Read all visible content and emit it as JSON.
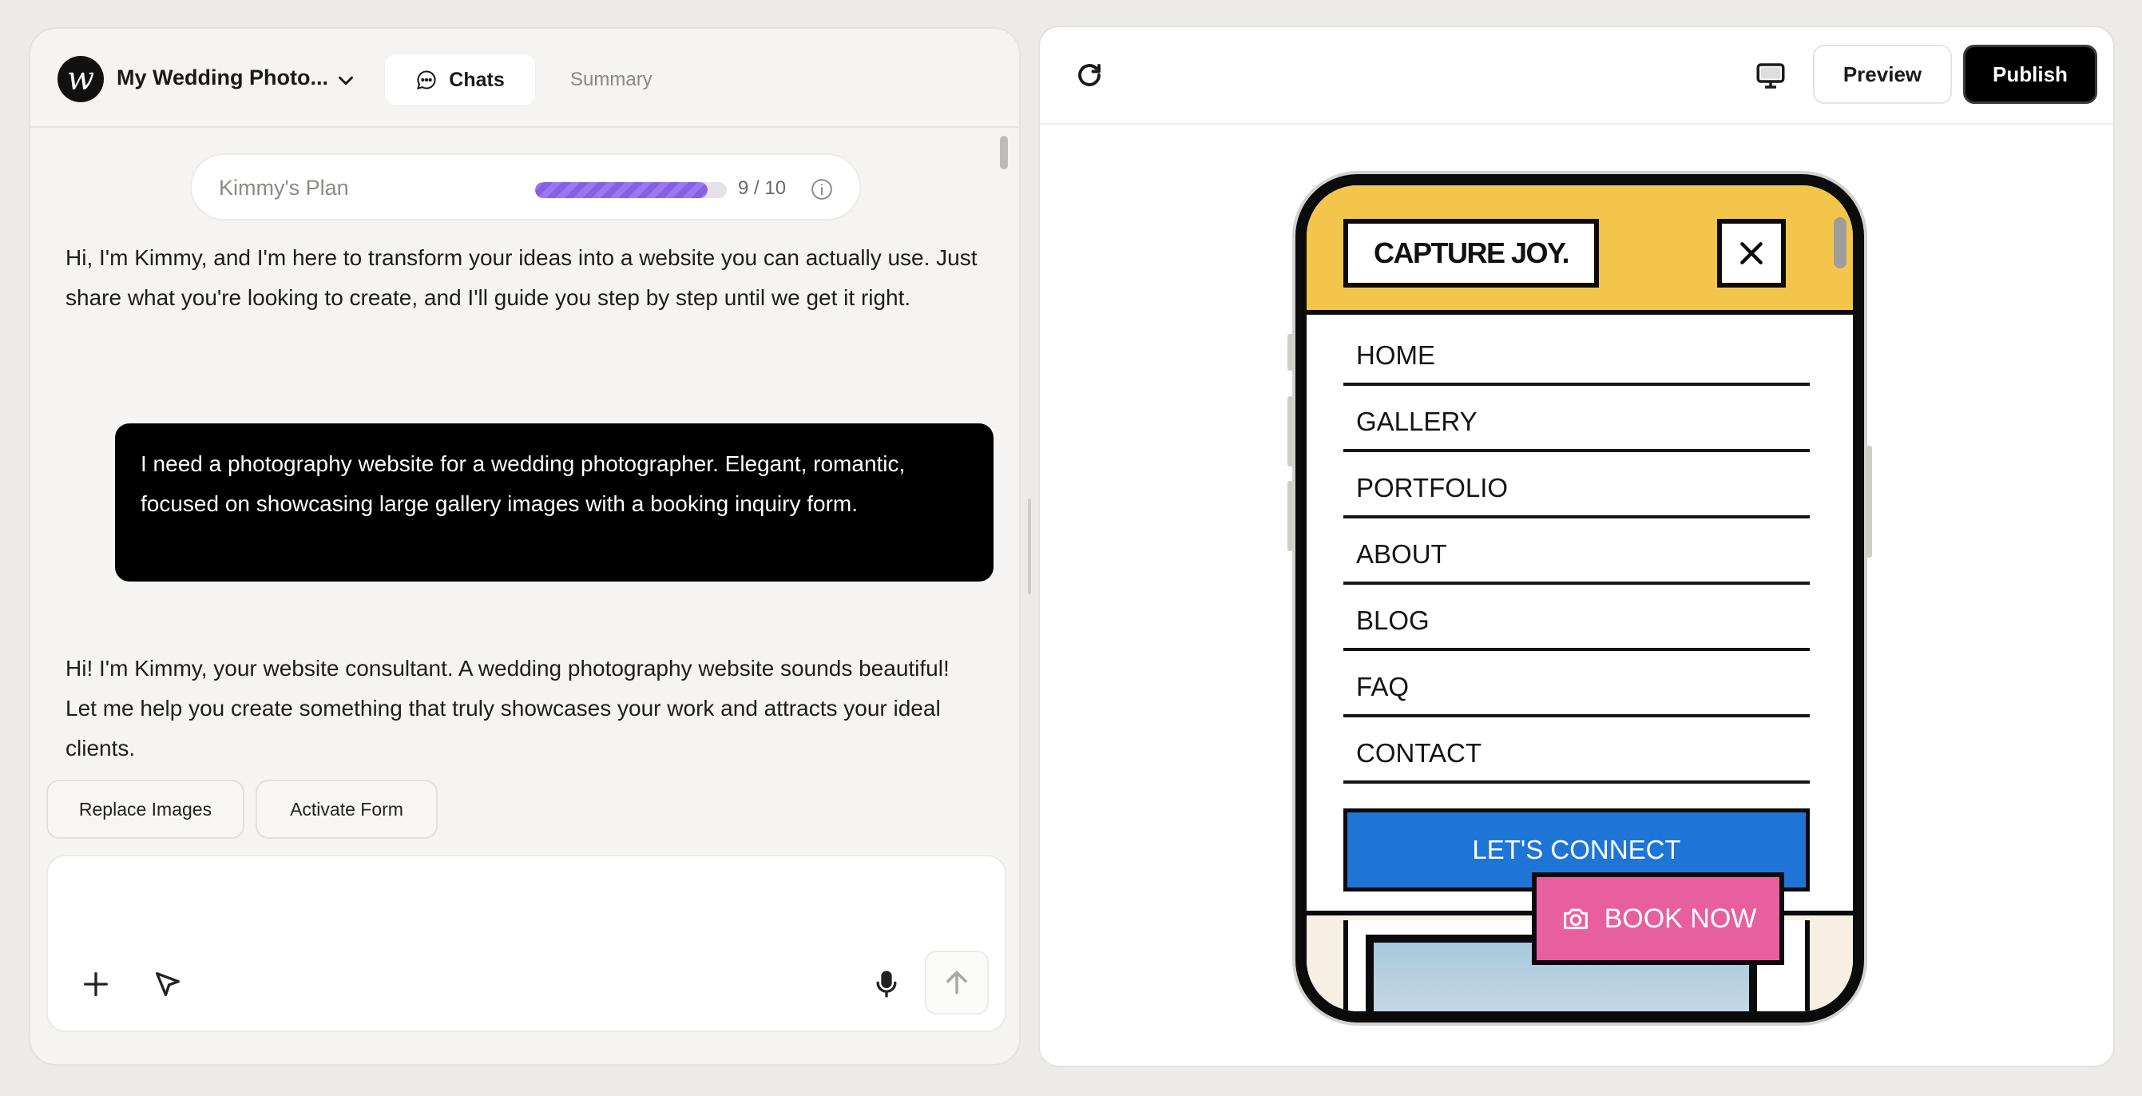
{
  "header": {
    "logo_letter": "w",
    "project_name": "My Wedding Photo...",
    "tabs": {
      "chats": "Chats",
      "summary": "Summary"
    }
  },
  "plan": {
    "label": "Kimmy's Plan",
    "used": 9,
    "total": 10,
    "count_text": "9 / 10",
    "fill_color": "#8560e3"
  },
  "messages": [
    {
      "role": "assistant",
      "text": "Hi, I'm Kimmy, and I'm here to transform your ideas into a website you can actually use. Just share what you're looking to create, and I'll guide you step by step until we get it right."
    },
    {
      "role": "user",
      "text": "I need a photography website for a wedding photographer. Elegant, romantic, focused on showcasing large gallery images with a booking inquiry form."
    },
    {
      "role": "assistant",
      "text": "Hi! I'm Kimmy, your website consultant. A wedding photography website sounds beautiful! Let me help you create something that truly showcases your work and attracts your ideal clients."
    }
  ],
  "suggestions": [
    "Replace Images",
    "Activate Form"
  ],
  "composer": {
    "placeholder": ""
  },
  "toolbar": {
    "preview_label": "Preview",
    "publish_label": "Publish"
  },
  "site": {
    "logo": "CAPTURE JOY.",
    "nav": [
      "HOME",
      "GALLERY",
      "PORTFOLIO",
      "ABOUT",
      "BLOG",
      "FAQ",
      "CONTACT"
    ],
    "connect_label": "LET'S CONNECT",
    "book_label": "BOOK NOW",
    "colors": {
      "header": "#f3c64b",
      "connect": "#1f75d6",
      "book": "#e85f9f"
    }
  },
  "icons": {
    "chats": "chat-bubble-icon",
    "info": "info-icon",
    "plus": "plus-icon",
    "cursor": "cursor-icon",
    "mic": "microphone-icon",
    "send": "arrow-up-icon",
    "refresh": "refresh-icon",
    "desktop": "desktop-icon",
    "close": "close-icon",
    "camera": "camera-icon"
  }
}
